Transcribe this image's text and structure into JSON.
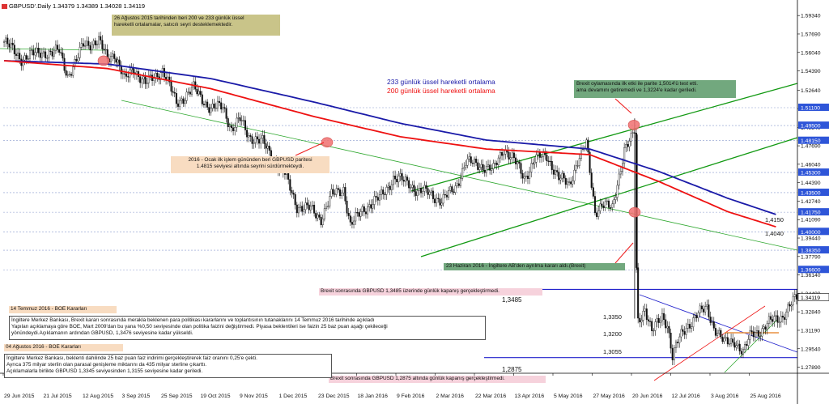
{
  "header": {
    "symbol": "GBPUSD'.Daily",
    "ohlc": "1.34379 1.34389 1.34028 1.34119"
  },
  "colors": {
    "ema233": "#1a1aa8",
    "ema200": "#ee1111",
    "channel": "#129912",
    "trend_thin": "#2fa82f",
    "level_line": "#2222cc",
    "dashed": "#8899cc",
    "candle": "#111111",
    "marker": "#f07070",
    "note_tan": "#c9c489",
    "note_peach": "#f8dcc1",
    "note_green": "#72a87e",
    "note_pink": "#f6d2dc",
    "price_tag": "#2e55d8"
  },
  "legend": {
    "ema233": "233 günlük üssel hareketli ortalama",
    "ema200": "200 günlük üssel hareketli ortalama"
  },
  "notes": {
    "aug2015": "26 Ağustos 2015 tarihinden beri 200 ve 233 günlük üssel\nhareketli ortalamalar, satıcılı seyri desteklemektedir.",
    "jan2016": "2016 - Ocak ilk işlem gününden beri GBPUSD paritesi\n1.4815 seviyesi altında seyrini sürdürmekteydi.",
    "brexit_vote": "Brexit oylamasında ilk etki ile parite 1,5014'ü test etti.\nama devamını getiremedi ve 1,3224'e kadar geriledi.",
    "jun23": "23 Haziran 2016 - İngiltere AB'den ayrılma kararı aldı.(Brexit)",
    "brexit_13485": "Brexit sonrasında GBPUSD 1,3485 üzerinde günlük kapanış   gerçekleştirmedi.",
    "brexit_12875": "Brexit sonrasında GBPUSD 1,2875 altında günlük kapanış  gerçekleştirmedi.",
    "boe_jul_title": "14 Temmuz 2016 - BOE Kararları",
    "boe_jul_body": "İngiltere Merkez Bankası, Brexit kararı sonrasında merakla beklenen para politikası kararlarını ve toplantısının tutanaklarını 14 Temmuz 2016 tarihinde açıkladı\nYapılan açıklamaya göre BOE, Mart 2009'dan bu yana %0,50 seviyesinde olan politika faizini değiştirmedi.  Piyasa beklentileri ise faizin 25 baz puan aşağı çekileceği\nyönündeydi.Açıklamanın ardından GBPUSD, 1,3476 seviyesine kadar  yükseldi.",
    "boe_aug_title": "04 Ağustos 2016 - BOE Kararları",
    "boe_aug_body": "İngiltere Merkez Bankası, beklenti dahilinde 25 baz puan faiz  indirimi gerçekleştirerek faiz oranını 0,25'e çekti.\nAyrıca 375 milyar sterlin olan parasal genişleme miktarını da 435  milyar sterline çıkarttı.\nAçıklamalarla birlikte GBPUSD 1,3345 seviyesinden 1,3155 seviyesine kadar geriledi."
  },
  "levels": {
    "l13485": "1,3485",
    "l12875": "1,2875",
    "l13350": "1,3350",
    "l13200": "1,3200",
    "l13055": "1,3055",
    "ema233_end": "1,4150",
    "ema200_end": "1,4040"
  },
  "chart_data": {
    "type": "candlestick",
    "instrument": "GBPUSD",
    "timeframe": "Daily",
    "x_tick_labels": [
      "29 Jun 2015",
      "21 Jul 2015",
      "12 Aug 2015",
      "3 Sep 2015",
      "25 Sep 2015",
      "19 Oct 2015",
      "9 Nov 2015",
      "1 Dec 2015",
      "23 Dec 2015",
      "18 Jan 2016",
      "9 Feb 2016",
      "2 Mar 2016",
      "22 Mar 2016",
      "13 Apr 2016",
      "5 May 2016",
      "27 May 2016",
      "20 Jun 2016",
      "12 Jul 2016",
      "3 Aug 2016",
      "25 Aug 2016"
    ],
    "y_tick_labels": [
      "1.59340",
      "1.57690",
      "1.56040",
      "1.54390",
      "1.52640",
      "1.50990",
      "1.49340",
      "1.47690",
      "1.46040",
      "1.44390",
      "1.42740",
      "1.41090",
      "1.39440",
      "1.37790",
      "1.36140",
      "1.34490",
      "1.32840",
      "1.31190",
      "1.29540",
      "1.27890"
    ],
    "ylim": [
      1.2735,
      1.6015
    ],
    "highlighted_levels": [
      "1.51100",
      "1.49500",
      "1.48150",
      "1.45300",
      "1.43500",
      "1.41750",
      "1.40000",
      "1.38350",
      "1.36600",
      "1.34119"
    ],
    "last_price": "1.34119",
    "grid": false,
    "approx_close_path": [
      [
        0,
        1.57
      ],
      [
        10,
        1.555
      ],
      [
        22,
        1.561
      ],
      [
        28,
        1.559
      ],
      [
        32,
        1.562
      ],
      [
        37,
        1.54
      ],
      [
        42,
        1.552
      ],
      [
        46,
        1.568
      ],
      [
        55,
        1.57
      ],
      [
        60,
        1.555
      ],
      [
        64,
        1.56
      ],
      [
        70,
        1.535
      ],
      [
        75,
        1.547
      ],
      [
        82,
        1.532
      ],
      [
        92,
        1.545
      ],
      [
        100,
        1.515
      ],
      [
        110,
        1.528
      ],
      [
        120,
        1.51
      ],
      [
        127,
        1.512
      ],
      [
        132,
        1.492
      ],
      [
        137,
        1.5
      ],
      [
        142,
        1.486
      ],
      [
        150,
        1.48
      ],
      [
        158,
        1.462
      ],
      [
        163,
        1.451
      ],
      [
        170,
        1.423
      ],
      [
        178,
        1.42
      ],
      [
        184,
        1.412
      ],
      [
        190,
        1.432
      ],
      [
        197,
        1.439
      ],
      [
        201,
        1.405
      ],
      [
        208,
        1.42
      ],
      [
        218,
        1.43
      ],
      [
        226,
        1.448
      ],
      [
        235,
        1.444
      ],
      [
        240,
        1.436
      ],
      [
        247,
        1.435
      ],
      [
        254,
        1.427
      ],
      [
        262,
        1.44
      ],
      [
        268,
        1.462
      ],
      [
        276,
        1.46
      ],
      [
        284,
        1.455
      ],
      [
        290,
        1.475
      ],
      [
        296,
        1.464
      ],
      [
        302,
        1.448
      ],
      [
        308,
        1.465
      ],
      [
        315,
        1.468
      ],
      [
        322,
        1.448
      ],
      [
        328,
        1.442
      ],
      [
        333,
        1.464
      ],
      [
        338,
        1.478
      ],
      [
        343,
        1.418
      ],
      [
        347,
        1.425
      ],
      [
        353,
        1.42
      ],
      [
        360,
        1.474
      ],
      [
        364,
        1.482
      ],
      [
        366,
        1.49
      ],
      [
        367,
        1.366
      ],
      [
        368,
        1.32
      ],
      [
        372,
        1.332
      ],
      [
        376,
        1.31
      ],
      [
        382,
        1.325
      ],
      [
        385,
        1.318
      ],
      [
        388,
        1.288
      ],
      [
        392,
        1.305
      ],
      [
        396,
        1.315
      ],
      [
        402,
        1.325
      ],
      [
        408,
        1.332
      ],
      [
        412,
        1.315
      ],
      [
        418,
        1.3
      ],
      [
        424,
        1.303
      ],
      [
        429,
        1.291
      ],
      [
        434,
        1.31
      ],
      [
        440,
        1.312
      ],
      [
        446,
        1.321
      ],
      [
        452,
        1.325
      ],
      [
        458,
        1.337
      ],
      [
        460,
        1.3412
      ]
    ],
    "series": [
      {
        "name": "233 günlük üssel hareketli ortalama",
        "color": "#1a1aa8",
        "values": [
          [
            0,
            1.553
          ],
          [
            60,
            1.55
          ],
          [
            120,
            1.537
          ],
          [
            180,
            1.516
          ],
          [
            230,
            1.497
          ],
          [
            280,
            1.482
          ],
          [
            340,
            1.474
          ],
          [
            380,
            1.454
          ],
          [
            420,
            1.43
          ],
          [
            449,
            1.415
          ]
        ]
      },
      {
        "name": "200 günlük üssel hareketli ortalama",
        "color": "#ee1111",
        "values": [
          [
            0,
            1.553
          ],
          [
            60,
            1.546
          ],
          [
            120,
            1.528
          ],
          [
            180,
            1.503
          ],
          [
            230,
            1.485
          ],
          [
            280,
            1.474
          ],
          [
            340,
            1.469
          ],
          [
            380,
            1.445
          ],
          [
            420,
            1.418
          ],
          [
            449,
            1.404
          ]
        ]
      }
    ]
  }
}
